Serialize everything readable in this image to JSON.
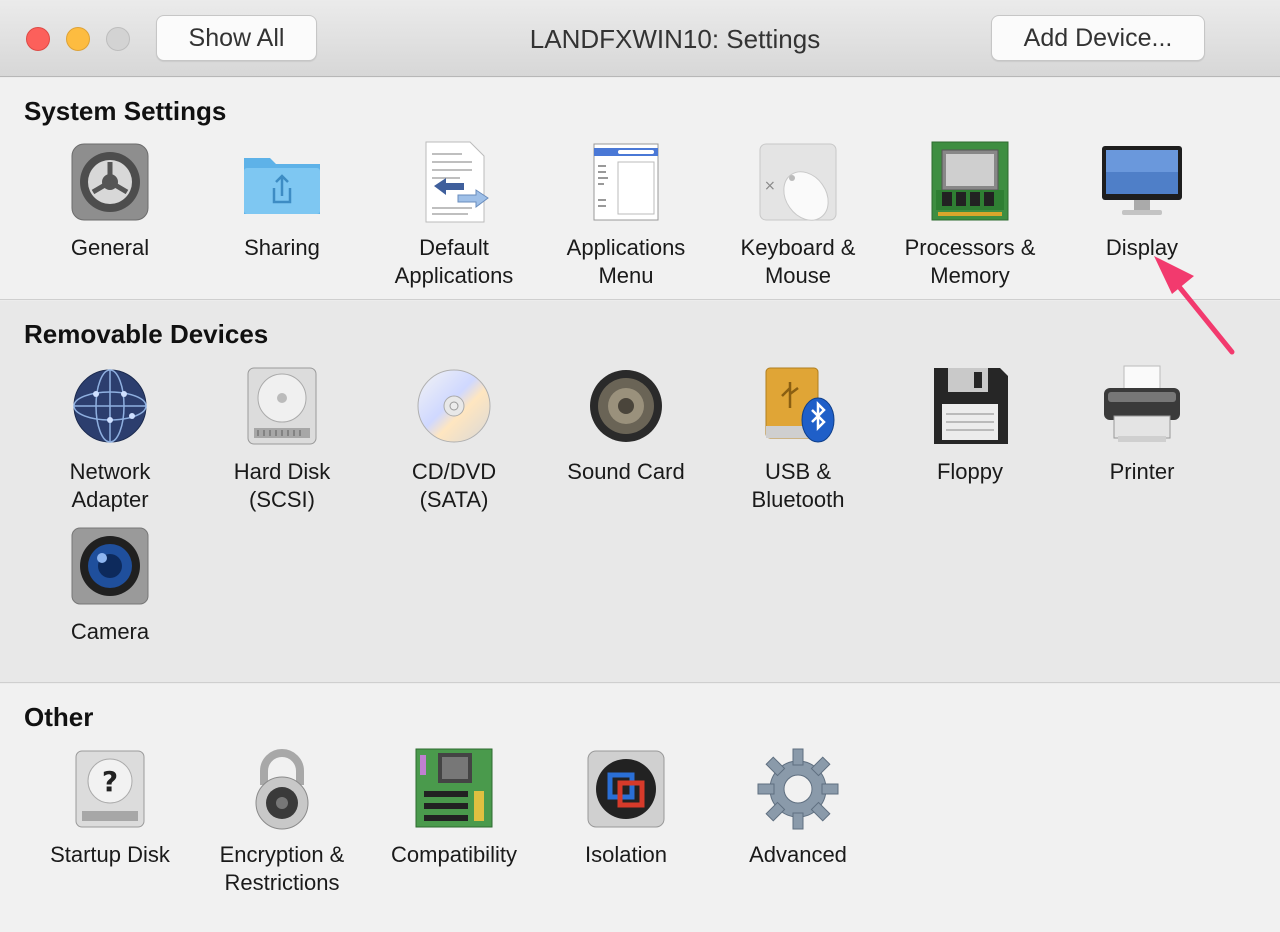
{
  "window": {
    "title": "LANDFXWIN10: Settings",
    "show_all_label": "Show All",
    "add_device_label": "Add Device..."
  },
  "sections": {
    "system": {
      "title": "System Settings",
      "items": [
        {
          "label": "General",
          "icon": "gear-icon"
        },
        {
          "label": "Sharing",
          "icon": "shared-folder-icon"
        },
        {
          "label": "Default\nApplications",
          "icon": "document-arrows-icon"
        },
        {
          "label": "Applications\nMenu",
          "icon": "menu-window-icon"
        },
        {
          "label": "Keyboard &\nMouse",
          "icon": "mouse-icon"
        },
        {
          "label": "Processors &\nMemory",
          "icon": "memory-chip-icon"
        },
        {
          "label": "Display",
          "icon": "monitor-icon"
        }
      ]
    },
    "removable": {
      "title": "Removable Devices",
      "items": [
        {
          "label": "Network\nAdapter",
          "icon": "network-globe-icon"
        },
        {
          "label": "Hard Disk\n(SCSI)",
          "icon": "hard-disk-icon"
        },
        {
          "label": "CD/DVD\n(SATA)",
          "icon": "cd-dvd-icon"
        },
        {
          "label": "Sound Card",
          "icon": "speaker-icon"
        },
        {
          "label": "USB &\nBluetooth",
          "icon": "usb-bluetooth-icon"
        },
        {
          "label": "Floppy",
          "icon": "floppy-disk-icon"
        },
        {
          "label": "Printer",
          "icon": "printer-icon"
        },
        {
          "label": "Camera",
          "icon": "camera-icon"
        }
      ]
    },
    "other": {
      "title": "Other",
      "items": [
        {
          "label": "Startup Disk",
          "icon": "startup-disk-icon"
        },
        {
          "label": "Encryption &\nRestrictions",
          "icon": "padlock-icon"
        },
        {
          "label": "Compatibility",
          "icon": "motherboard-icon"
        },
        {
          "label": "Isolation",
          "icon": "isolation-icon"
        },
        {
          "label": "Advanced",
          "icon": "cog-icon"
        }
      ]
    }
  },
  "colors": {
    "close": "#fc605b",
    "minimize": "#fdbc40",
    "zoom_disabled": "#d3d3d3",
    "annotation_arrow": "#f23a6e"
  }
}
